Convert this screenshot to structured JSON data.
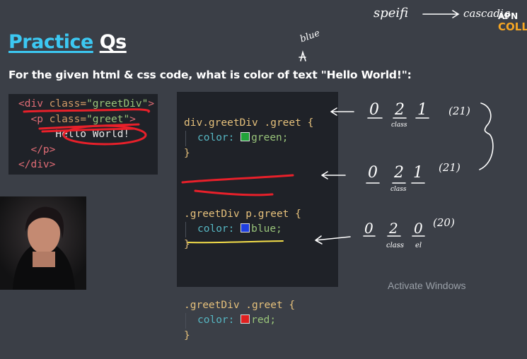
{
  "title": {
    "word1": "Practice",
    "word2": "Qs"
  },
  "question": "For the given html & css code, what is color of text \"Hello World!\":",
  "html_code": {
    "line1": {
      "open": "<",
      "tag": "div",
      "attr": "class=",
      "value": "\"greetDiv\"",
      "close": ">"
    },
    "line2": {
      "open": "<",
      "tag": "p",
      "attr": "class=",
      "value": "\"greet\"",
      "close": ">"
    },
    "line3": "Hello World!",
    "line4": {
      "text": "</p>"
    },
    "line5": {
      "text": "</div>"
    }
  },
  "css_code": [
    {
      "selector": "div.greetDiv .greet",
      "property": "color:",
      "value": "green;",
      "swatch": "#22a33a"
    },
    {
      "selector": ".greetDiv p.greet",
      "property": "color:",
      "value": "blue;",
      "swatch": "#1f3fe0"
    },
    {
      "selector": ".greetDiv .greet",
      "property": "color:",
      "value": "red;",
      "swatch": "#e02020"
    }
  ],
  "code_brace_open": "{",
  "code_brace_close": "}",
  "annotations": {
    "top_left_word": "speifi",
    "top_right_word": "cascadig",
    "blue_note": "blue",
    "row1": {
      "a": "0",
      "b": "2",
      "c": "1",
      "score": "(21)",
      "b_label": "class"
    },
    "row2": {
      "a": "0",
      "b": "2",
      "c": "1",
      "score": "(21)",
      "b_label": "class"
    },
    "row3": {
      "a": "0",
      "b": "2",
      "c": "0",
      "score": "(20)",
      "b_label": "class",
      "c_label": "el"
    }
  },
  "logo": {
    "line1": "APN",
    "line2": "COLL"
  },
  "watermark": "Activate Windows",
  "colors": {
    "title_accent": "#3cc8f2",
    "panel_bg": "#1f2228",
    "page_bg": "#3b3f47",
    "ink": "#e8202a"
  }
}
